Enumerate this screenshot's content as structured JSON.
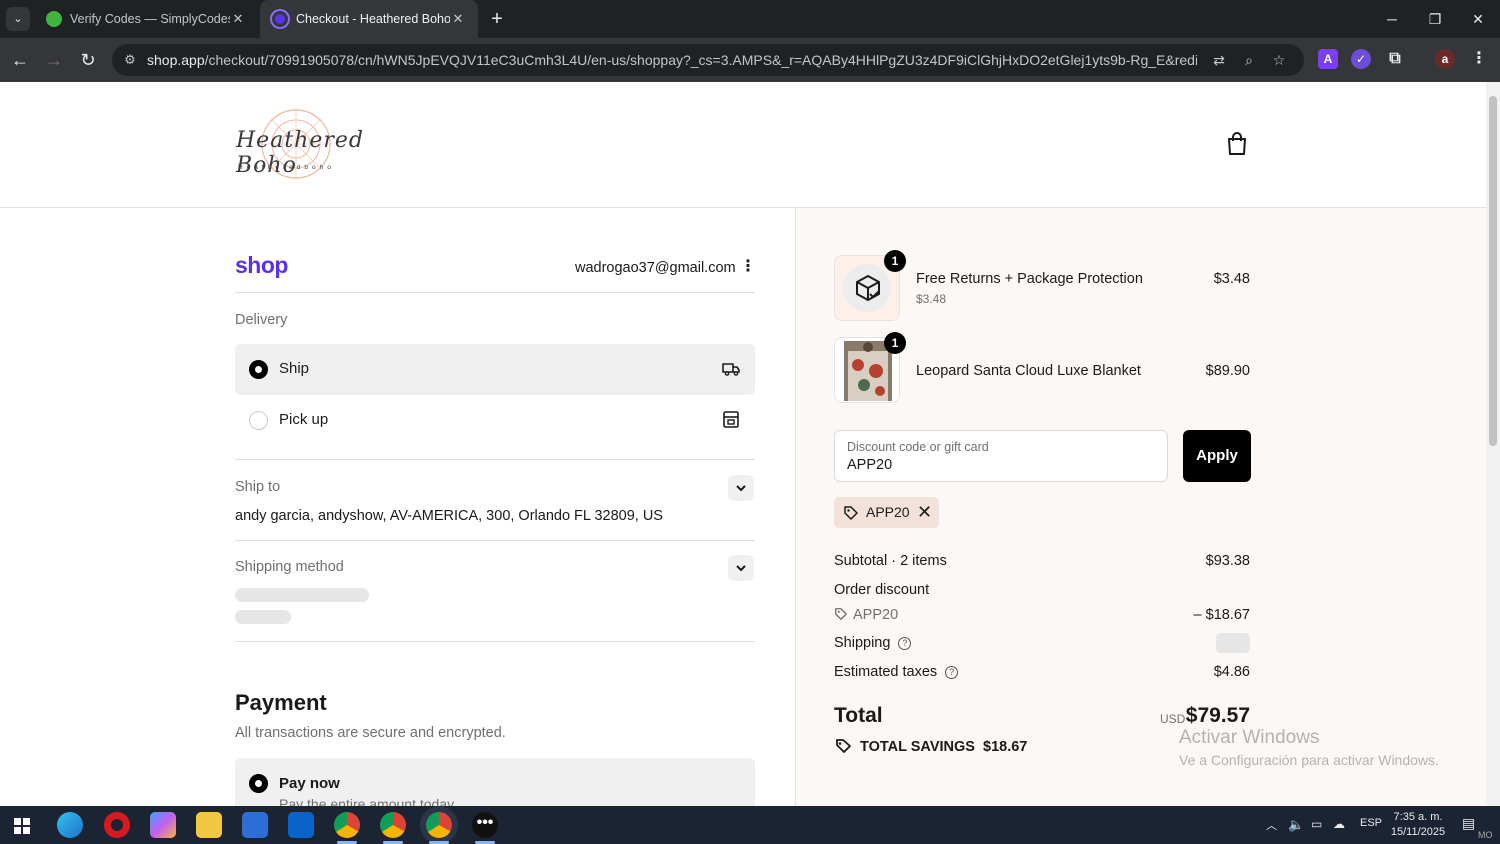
{
  "browser": {
    "tabs": [
      {
        "title": "Verify Codes — SimplyCodes",
        "active": false
      },
      {
        "title": "Checkout - Heathered Boho",
        "active": true
      }
    ],
    "url_host": "shop.app",
    "url_path": "/checkout/70991905078/cn/hWN5JpEVQJV11eC3uCmh3L4U/en-us/shoppay?_cs=3.AMPS&_r=AQABy4HHlPgZU3z4DF9iClGhjHxDO2etGlej1yts9b-Rg_E&redirect_source=c...",
    "profile_initial": "a"
  },
  "store": {
    "logo_text": "Heathered Boho",
    "logo_sub": "Heatheredboho"
  },
  "checkout": {
    "shop_label": "shop",
    "email": "wadrogao37@gmail.com",
    "delivery_label": "Delivery",
    "delivery_options": [
      {
        "label": "Ship",
        "selected": true
      },
      {
        "label": "Pick up",
        "selected": false
      }
    ],
    "ship_to_label": "Ship to",
    "ship_to_value": "andy garcia, andyshow, AV-AMERICA, 300, Orlando FL 32809, US",
    "shipping_method_label": "Shipping method",
    "payment_title": "Payment",
    "payment_sub": "All transactions are secure and encrypted.",
    "pay_now_label": "Pay now",
    "pay_now_desc": "Pay the entire amount today"
  },
  "summary": {
    "items": [
      {
        "qty": "1",
        "name": "Free Returns + Package Protection",
        "sub": "$3.48",
        "price": "$3.48"
      },
      {
        "qty": "1",
        "name": "Leopard Santa Cloud Luxe Blanket",
        "sub": "",
        "price": "$89.90"
      }
    ],
    "discount_placeholder": "Discount code or gift card",
    "discount_value": "APP20",
    "apply_label": "Apply",
    "applied_code": "APP20",
    "subtotal_label": "Subtotal · 2 items",
    "subtotal_value": "$93.38",
    "order_discount_label": "Order discount",
    "order_discount_code": "APP20",
    "order_discount_value": "– $18.67",
    "shipping_label": "Shipping",
    "taxes_label": "Estimated taxes",
    "taxes_value": "$4.86",
    "total_label": "Total",
    "total_currency": "USD",
    "total_value": "$79.57",
    "savings_label": "TOTAL SAVINGS",
    "savings_value": "$18.67"
  },
  "watermark": {
    "line1": "Activar Windows",
    "line2": "Ve a Configuración para activar Windows."
  },
  "taskbar": {
    "lang": "ESP",
    "time": "7:35 a. m.",
    "date": "15/11/2025",
    "notif": "MO"
  },
  "colors": {
    "shop_purple": "#5a31f4",
    "summary_bg": "#fcf8f6",
    "chip_bg": "#f3e2da"
  }
}
